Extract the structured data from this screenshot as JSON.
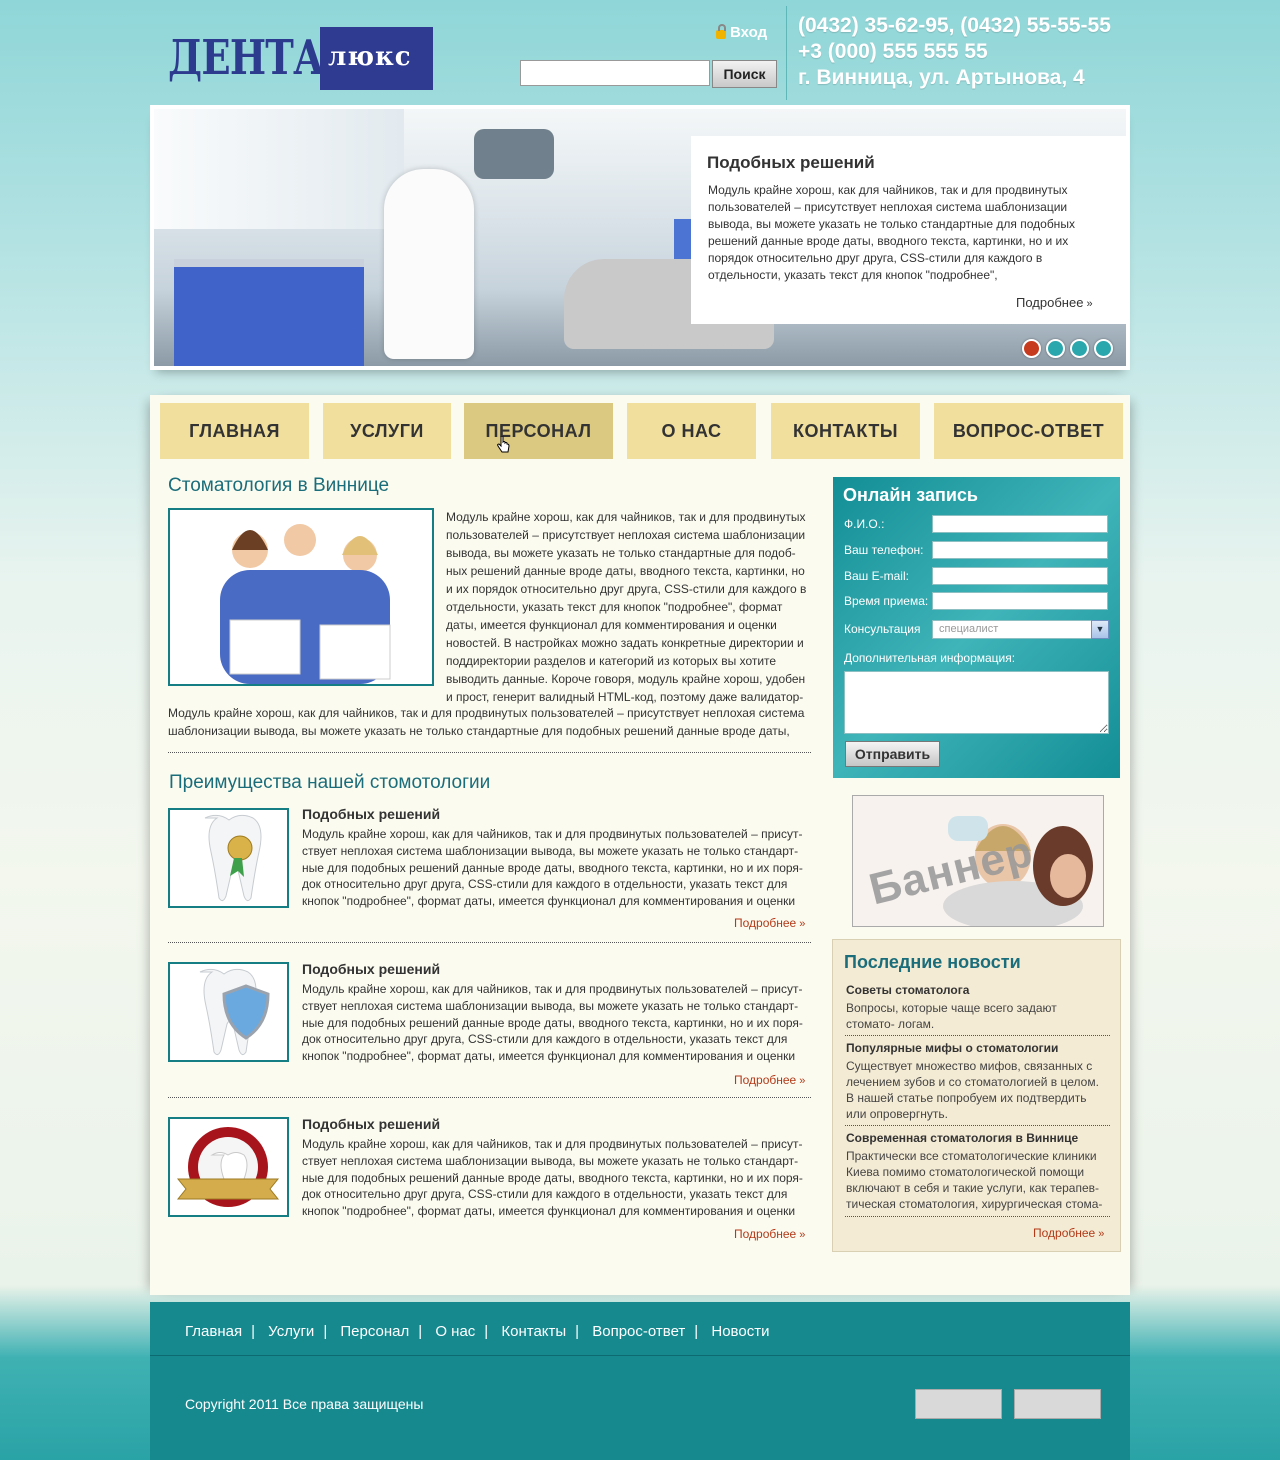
{
  "header": {
    "logo_main": "ДЕНТАЛ",
    "logo_sub": "люкс",
    "login_label": "Вход",
    "search_placeholder": "",
    "search_button": "Поиск",
    "phones": "(0432) 35-62-95, (0432) 55-55-55",
    "phone2": "+3 (000) 555 555 55",
    "address": "г. Винница, ул. Артынова, 4"
  },
  "slider": {
    "title": "Подобных решений",
    "text": "Модуль крайне хорош, как для чайников, так и для продвинутых пользователей – присутствует неплохая система шаблонизации вывода, вы можете указать не только стандартные для подобных решений данные вроде даты, вводного текста, картинки, но и их порядок относительно друг друга, CSS-стили для каждого в отдельности, указать текст для кнопок \"подробнее\",",
    "more": "Подробнее",
    "dots": [
      "#c63a1d",
      "#2aa7ac",
      "#2aa7ac",
      "#2aa7ac"
    ]
  },
  "nav": [
    "ГЛАВНАЯ",
    "УСЛУГИ",
    "ПЕРСОНАЛ",
    "О НАС",
    "КОНТАКТЫ",
    "ВОПРОС-ОТВЕТ"
  ],
  "intro": {
    "title": "Стоматология в Виннице",
    "text": "Модуль крайне хорош, как для чайников, так и для продвинутых пользователей – присутствует неплохая система шаблонизации вывода, вы можете указать не только стандартные для подоб- ных решений данные вроде даты, вводного текста, картинки, но и их порядок относительно друг друга, CSS-стили для каждого в отдельности, указать текст для кнопок \"подробнее\", формат даты, имеется функционал для комментирования и оценки новостей. В настройках можно задать конкретные директории и поддиректории разделов и категорий из которых вы хотите выводить данные. Короче говоря, модуль крайне хорош, удобен и прост, генерит валидный HTML-код, поэтому даже валидатор-",
    "text2": "Модуль крайне хорош, как для чайников, так и для продвинутых пользователей – присутствует неплохая система шаблонизации вывода, вы можете указать не только стандартные для подобных решений данные вроде даты,"
  },
  "advantages": {
    "title": "Преимущества нашей стомотологии",
    "items": [
      {
        "title": "Подобных решений",
        "text": "Модуль крайне хорош, как для чайников, так и для продвинутых пользователей – присут- ствует неплохая система шаблонизации вывода, вы можете указать не только стандарт- ные для подобных решений данные вроде даты, вводного текста, картинки, но и их поря- док относительно друг друга, CSS-стили для каждого в отдельности, указать текст для кнопок \"подробнее\", формат даты, имеется функционал для комментирования и оценки",
        "more": "Подробнее",
        "icon": "tooth-medal-icon"
      },
      {
        "title": "Подобных решений",
        "text": "Модуль крайне хорош, как для чайников, так и для продвинутых пользователей – присут- ствует неплохая система шаблонизации вывода, вы можете указать не только стандарт- ные для подобных решений данные вроде даты, вводного текста, картинки, но и их поря- док относительно друг друга, CSS-стили для каждого в отдельности, указать текст для кнопок \"подробнее\", формат даты, имеется функционал для комментирования и оценки",
        "more": "Подробнее",
        "icon": "tooth-shield-icon"
      },
      {
        "title": "Подобных решений",
        "text": "Модуль крайне хорош, как для чайников, так и для продвинутых пользователей – присут- ствует неплохая система шаблонизации вывода, вы можете указать не только стандарт- ные для подобных решений данные вроде даты, вводного текста, картинки, но и их поря- док относительно друг друга, CSS-стили для каждого в отдельности, указать текст для кнопок \"подробнее\", формат даты, имеется функционал для комментирования и оценки",
        "more": "Подробнее",
        "icon": "tooth-badge-icon"
      }
    ]
  },
  "form": {
    "title": "Онлайн запись",
    "fio": "Ф.И.О.:",
    "phone": "Ваш телефон:",
    "email": "Ваш E-mail:",
    "time": "Время приема:",
    "consult": "Консультация",
    "consult_value": "специалист",
    "extra": "Дополнительная информация:",
    "submit": "Отправить"
  },
  "banner": {
    "text": "Баннер"
  },
  "news": {
    "title": "Последние новости",
    "items": [
      {
        "title": "Советы стоматолога",
        "text": "Вопросы, которые чаще всего задают стомато- логам."
      },
      {
        "title": "Популярные мифы о стоматологии",
        "text": "Существует множество мифов, связанных с лечением зубов и со стоматологией в целом. В нашей статье попробуем их подтвердить или опровергнуть."
      },
      {
        "title": "Современная стоматология в Виннице",
        "text": "Практически все стоматологические клиники Киева помимо стоматологической помощи включают в себя и такие услуги, как терапев- тическая стоматология, хирургическая стома-"
      }
    ],
    "more": "Подробнее"
  },
  "footer": {
    "links": [
      "Главная",
      "Услуги",
      "Персонал",
      "О нас",
      "Контакты",
      "Вопрос-ответ",
      "Новости"
    ],
    "copyright": "Copyright 2011 Все права защищены"
  }
}
